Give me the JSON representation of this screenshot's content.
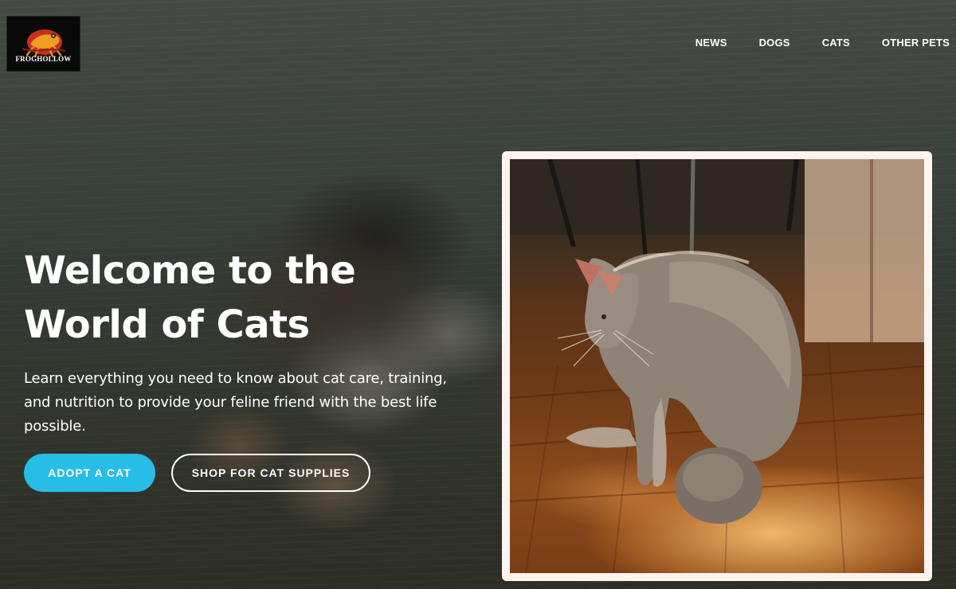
{
  "header": {
    "logo_text": "FROGHOLLOW",
    "nav": [
      {
        "label": "NEWS"
      },
      {
        "label": "DOGS"
      },
      {
        "label": "CATS"
      },
      {
        "label": "OTHER PETS"
      }
    ]
  },
  "hero": {
    "title": "Welcome to the World of Cats",
    "subtitle": "Learn everything you need to know about cat care, training, and nutrition to provide your feline friend with the best life possible.",
    "primary_button": "ADOPT A CAT",
    "secondary_button": "SHOP FOR CAT SUPPLIES"
  },
  "colors": {
    "primary_button_bg": "#28bde6",
    "card_frame": "#fdf3ef",
    "text": "#ffffff"
  },
  "icons": {
    "logo": "frog-logo-icon"
  }
}
